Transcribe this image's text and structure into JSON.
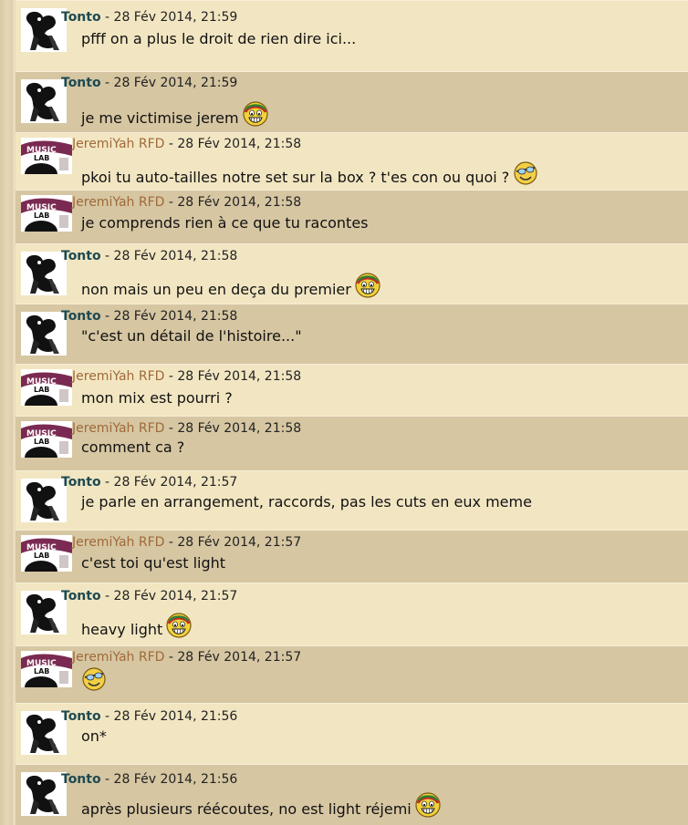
{
  "separator": " - ",
  "messages": [
    {
      "user": "Tonto",
      "date": "28 Fév 2014, 21:59",
      "text": "pfff on a plus le droit de rien dire ici...",
      "smiley": "",
      "avatar": "tonto-avatar"
    },
    {
      "user": "Tonto",
      "date": "28 Fév 2014, 21:59",
      "text": "je me victimise jerem",
      "smiley": "grin",
      "avatar": "tonto-avatar"
    },
    {
      "user": "JeremiYah RFD",
      "date": "28 Fév 2014, 21:58",
      "text": "pkoi tu auto-tailles notre set sur la box ? t'es con ou quoi ?",
      "smiley": "wink",
      "avatar": "music-lab-avatar"
    },
    {
      "user": "JeremiYah RFD",
      "date": "28 Fév 2014, 21:58",
      "text": "je comprends rien à ce que tu racontes",
      "smiley": "",
      "avatar": "music-lab-avatar"
    },
    {
      "user": "Tonto",
      "date": "28 Fév 2014, 21:58",
      "text": "non mais un peu en deça du premier",
      "smiley": "grin",
      "avatar": "tonto-avatar"
    },
    {
      "user": "Tonto",
      "date": "28 Fév 2014, 21:58",
      "text": "\"c'est un détail de l'histoire...\"",
      "smiley": "",
      "avatar": "tonto-avatar"
    },
    {
      "user": "JeremiYah RFD",
      "date": "28 Fév 2014, 21:58",
      "text": "mon mix est pourri ?",
      "smiley": "",
      "avatar": "music-lab-avatar"
    },
    {
      "user": "JeremiYah RFD",
      "date": "28 Fév 2014, 21:58",
      "text": "comment ca ?",
      "smiley": "",
      "avatar": "music-lab-avatar"
    },
    {
      "user": "Tonto",
      "date": "28 Fév 2014, 21:57",
      "text": "je parle en arrangement, raccords, pas les cuts en eux meme",
      "smiley": "",
      "avatar": "tonto-avatar"
    },
    {
      "user": "JeremiYah RFD",
      "date": "28 Fév 2014, 21:57",
      "text": "c'est toi qu'est light",
      "smiley": "",
      "avatar": "music-lab-avatar"
    },
    {
      "user": "Tonto",
      "date": "28 Fév 2014, 21:57",
      "text": "heavy light",
      "smiley": "grin",
      "avatar": "tonto-avatar"
    },
    {
      "user": "JeremiYah RFD",
      "date": "28 Fév 2014, 21:57",
      "text": "",
      "smiley": "wink",
      "avatar": "music-lab-avatar"
    },
    {
      "user": "Tonto",
      "date": "28 Fév 2014, 21:56",
      "text": "on*",
      "smiley": "",
      "avatar": "tonto-avatar"
    },
    {
      "user": "Tonto",
      "date": "28 Fév 2014, 21:56",
      "text": "après plusieurs réécoutes, no est light réjemi",
      "smiley": "grin",
      "avatar": "tonto-avatar"
    }
  ],
  "colors": {
    "light_row": "#f2e6c2",
    "dark_row": "#d6c6a2",
    "tonto": "#1d4a52",
    "jeremi": "#a06a3a"
  }
}
